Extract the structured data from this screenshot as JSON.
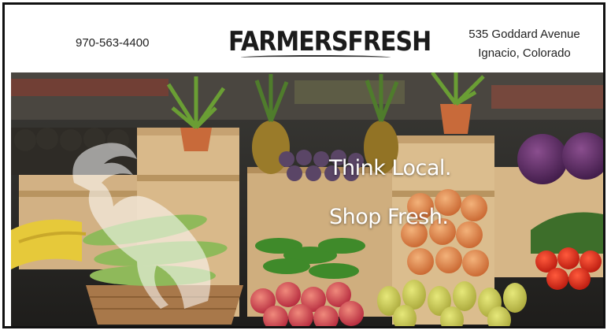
{
  "header": {
    "phone": "970-563-4400",
    "logo_text": "FARMERSFRESH",
    "address_line1": "535 Goddard Avenue",
    "address_line2": "Ignacio, Colorado"
  },
  "hero": {
    "tagline_1": "Think Local.",
    "tagline_2": "Shop Fresh."
  },
  "colors": {
    "text": "#222222",
    "frame": "#111111",
    "tagline": "#ffffff"
  }
}
